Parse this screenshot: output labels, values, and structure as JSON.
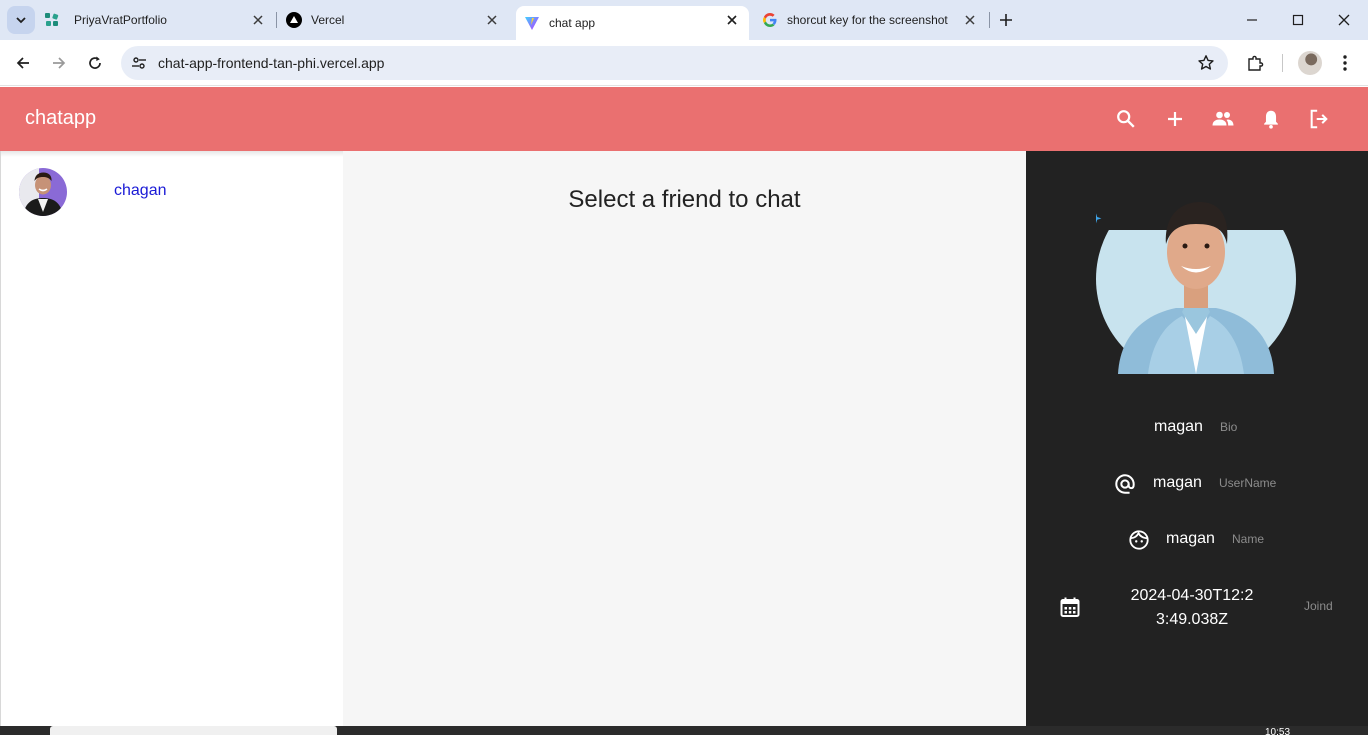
{
  "browser": {
    "tabs": [
      {
        "title": "PriyaVratPortfolio",
        "icon": "portfolio-favicon"
      },
      {
        "title": "Vercel",
        "icon": "vercel-favicon"
      },
      {
        "title": "chat app",
        "icon": "vite-favicon",
        "active": true
      },
      {
        "title": "shorcut key for the screenshot",
        "icon": "google-favicon"
      }
    ],
    "url": "chat-app-frontend-tan-phi.vercel.app"
  },
  "app": {
    "brand": "chatapp",
    "header_icons": [
      "search-icon",
      "add-icon",
      "group-icon",
      "notifications-icon",
      "logout-icon"
    ],
    "colors": {
      "accent": "#ea7070",
      "panel": "#222222",
      "chat_bg": "#f6f6f6",
      "link": "#1a1ad6"
    }
  },
  "friends": [
    {
      "name": "chagan"
    }
  ],
  "chat": {
    "placeholder": "Select a friend to chat"
  },
  "profile": {
    "bio": {
      "value": "magan",
      "label": "Bio"
    },
    "username": {
      "value": "magan",
      "label": "UserName"
    },
    "name": {
      "value": "magan",
      "label": "Name"
    },
    "joined": {
      "value": "2024-04-30T12:23:49.038Z",
      "label": "Joind"
    }
  },
  "taskbar": {
    "time": "10:53"
  }
}
